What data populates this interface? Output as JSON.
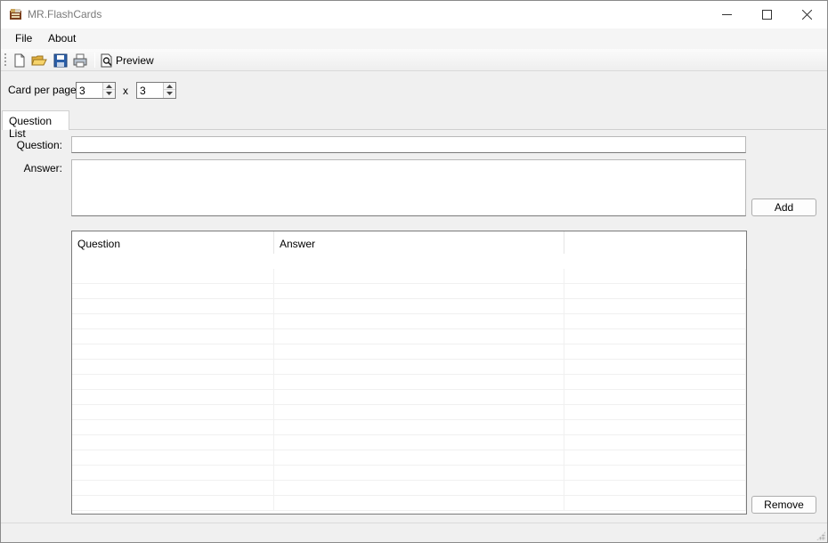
{
  "window": {
    "title": "MR.FlashCards"
  },
  "menu": {
    "items": [
      "File",
      "About"
    ]
  },
  "toolbar": {
    "buttons": [
      "new-file-icon",
      "open-folder-icon",
      "save-disk-icon",
      "print-icon",
      "print-preview-icon"
    ],
    "preview_label": "Preview"
  },
  "card_settings": {
    "label": "Card per page :",
    "columns": "3",
    "separator": "x",
    "rows": "3"
  },
  "tabs": [
    {
      "label": "Question List",
      "active": true
    }
  ],
  "form": {
    "question_label": "Question:",
    "question_value": "",
    "answer_label": "Answer:",
    "answer_value": ""
  },
  "buttons": {
    "add": "Add",
    "remove": "Remove"
  },
  "list": {
    "headers": [
      "Question",
      "Answer",
      ""
    ],
    "rows": []
  },
  "colors": {
    "window_bg": "#f0f0f0",
    "title_text": "#7a7a7a"
  }
}
